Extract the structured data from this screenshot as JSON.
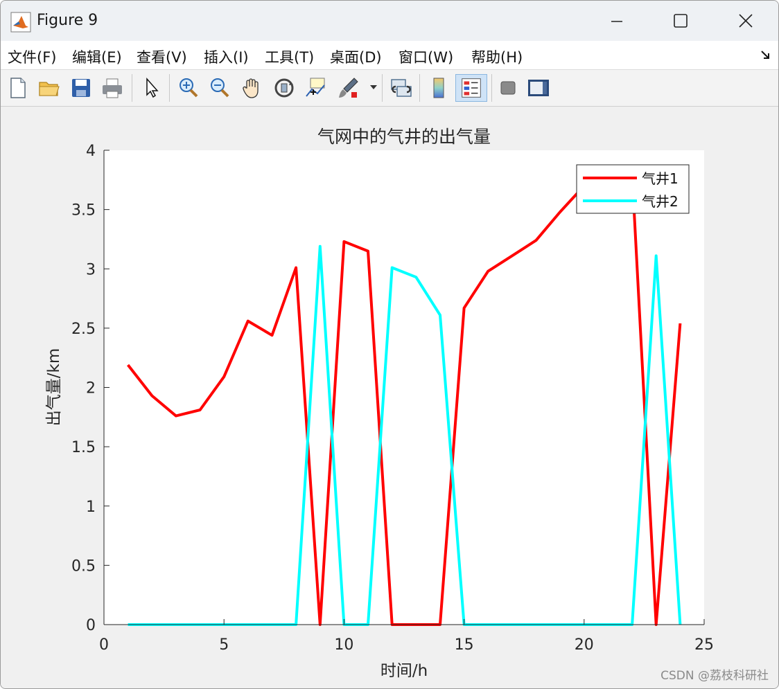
{
  "window": {
    "title": "Figure 9"
  },
  "menu": {
    "items": [
      "文件(F)",
      "编辑(E)",
      "查看(V)",
      "插入(I)",
      "工具(T)",
      "桌面(D)",
      "窗口(W)",
      "帮助(H)"
    ]
  },
  "toolbar": {
    "icons": [
      "new-figure-icon",
      "open-folder-icon",
      "save-icon",
      "print-icon",
      "select-arrow-icon",
      "zoom-in-icon",
      "zoom-out-icon",
      "pan-hand-icon",
      "rotate-3d-icon",
      "data-cursor-icon",
      "brush-icon",
      "link-plot-icon",
      "colorbar-icon",
      "legend-icon",
      "hide-plot-tools-icon",
      "show-plot-tools-icon"
    ],
    "active": "legend-icon"
  },
  "watermark": "CSDN @荔枝科研社",
  "chart_data": {
    "type": "line",
    "title": "气网中的气井的出气量",
    "xlabel": "时间/h",
    "ylabel": "出气量/km",
    "xlim": [
      0,
      25
    ],
    "ylim": [
      0,
      4
    ],
    "xticks": [
      "0",
      "5",
      "10",
      "15",
      "20",
      "25"
    ],
    "yticks": [
      "0",
      "0.5",
      "1",
      "1.5",
      "2",
      "2.5",
      "3",
      "3.5",
      "4"
    ],
    "legend_position": "top-right",
    "grid": false,
    "x": [
      1,
      2,
      3,
      4,
      5,
      6,
      7,
      8,
      9,
      10,
      11,
      12,
      13,
      14,
      15,
      16,
      17,
      18,
      19,
      20,
      21,
      22,
      23,
      24
    ],
    "series": [
      {
        "name": "气井1",
        "color": "#ff0000",
        "values": [
          2.19,
          1.93,
          1.76,
          1.81,
          2.09,
          2.56,
          2.44,
          3.01,
          0,
          3.23,
          3.15,
          0,
          0,
          0,
          2.67,
          2.98,
          3.11,
          3.24,
          3.48,
          3.7,
          3.85,
          3.8,
          0,
          2.54
        ]
      },
      {
        "name": "气井2",
        "color": "#00ffff",
        "values": [
          0,
          0,
          0,
          0,
          0,
          0,
          0,
          0,
          3.19,
          0,
          0,
          3.01,
          2.93,
          2.61,
          0,
          0,
          0,
          0,
          0,
          0,
          0,
          0,
          3.11,
          0
        ]
      }
    ]
  }
}
